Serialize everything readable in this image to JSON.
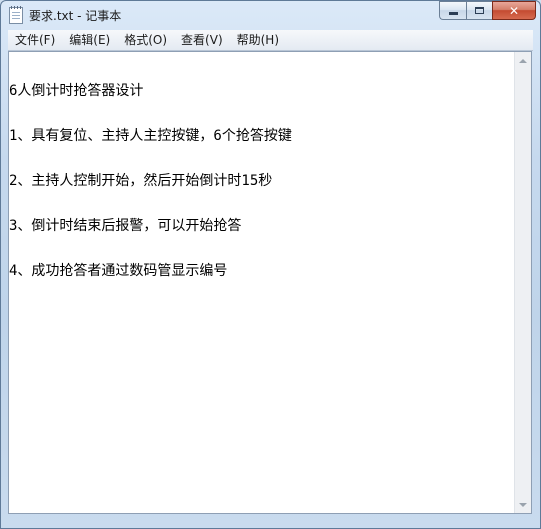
{
  "window": {
    "title": "要求.txt - 记事本",
    "icon": "notepad-icon",
    "caption": {
      "minimize_icon": "minimize-icon",
      "maximize_icon": "maximize-icon",
      "close_label": "✕"
    }
  },
  "menubar": {
    "items": [
      {
        "label": "文件(F)"
      },
      {
        "label": "编辑(E)"
      },
      {
        "label": "格式(O)"
      },
      {
        "label": "查看(V)"
      },
      {
        "label": "帮助(H)"
      }
    ]
  },
  "editor": {
    "lines": [
      "6人倒计时抢答器设计",
      "1、具有复位、主持人主控按键，6个抢答按键",
      "2、主持人控制开始，然后开始倒计时15秒",
      "3、倒计时结束后报警，可以开始抢答",
      "4、成功抢答者通过数码管显示编号"
    ]
  },
  "colors": {
    "close_button": "#c44b31",
    "frame": "#c6d9ee",
    "text": "#000000"
  }
}
